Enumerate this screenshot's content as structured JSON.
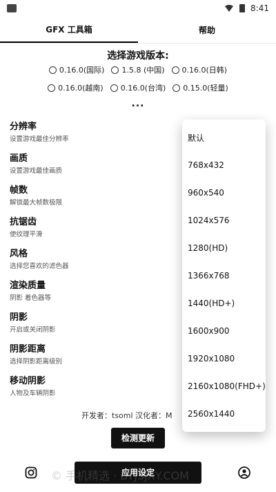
{
  "status_bar": {
    "time": "8:41"
  },
  "tabs": [
    {
      "label": "GFX 工具箱"
    },
    {
      "label": "帮助"
    }
  ],
  "version_section": {
    "title": "选择游戏版本:",
    "row1": [
      {
        "label": "0.16.0(国际)"
      },
      {
        "label": "1.5.8 (中国)"
      },
      {
        "label": "0.16.0(日韩)"
      }
    ],
    "row2": [
      {
        "label": "0.16.0(越南)"
      },
      {
        "label": "0.16.0(台湾)"
      },
      {
        "label": "0.15.0(轻量)"
      }
    ],
    "more": "..."
  },
  "settings": [
    {
      "name": "分辨率",
      "desc": "设置游戏最佳分辨率"
    },
    {
      "name": "画质",
      "desc": "设置游戏最佳画质"
    },
    {
      "name": "帧数",
      "desc": "解锁最大帧数极限"
    },
    {
      "name": "抗锯齿",
      "desc": "使纹理平滑"
    },
    {
      "name": "风格",
      "desc": "选择您喜欢的滤色器"
    },
    {
      "name": "渲染质量",
      "desc": "阴影 着色器等"
    },
    {
      "name": "阴影",
      "desc": "开启或关闭阴影"
    },
    {
      "name": "阴影距离",
      "desc": "选择阴影距离级别"
    },
    {
      "name": "移动阴影",
      "desc": "人物及车辆阴影"
    }
  ],
  "credits": "开发者：tsoml   汉化者：M",
  "buttons": {
    "check_update": "检测更新",
    "apply_settings": "应用设定"
  },
  "dropdown": {
    "options": [
      "默认",
      "768x432",
      "960x540",
      "1024x576",
      "1280(HD)",
      "1366x768",
      "1440(HD+)",
      "1600x900",
      "1920x1080",
      "2160x1080(FHD+)",
      "2560x1440"
    ]
  },
  "watermark": "© 手机精选 · BYJSJXY.COM",
  "icons": {
    "status_left": "notification-square-icon",
    "wifi": "wifi-icon",
    "battery": "battery-icon",
    "bottom_left": "instagram-icon",
    "bottom_right": "profile-icon"
  }
}
